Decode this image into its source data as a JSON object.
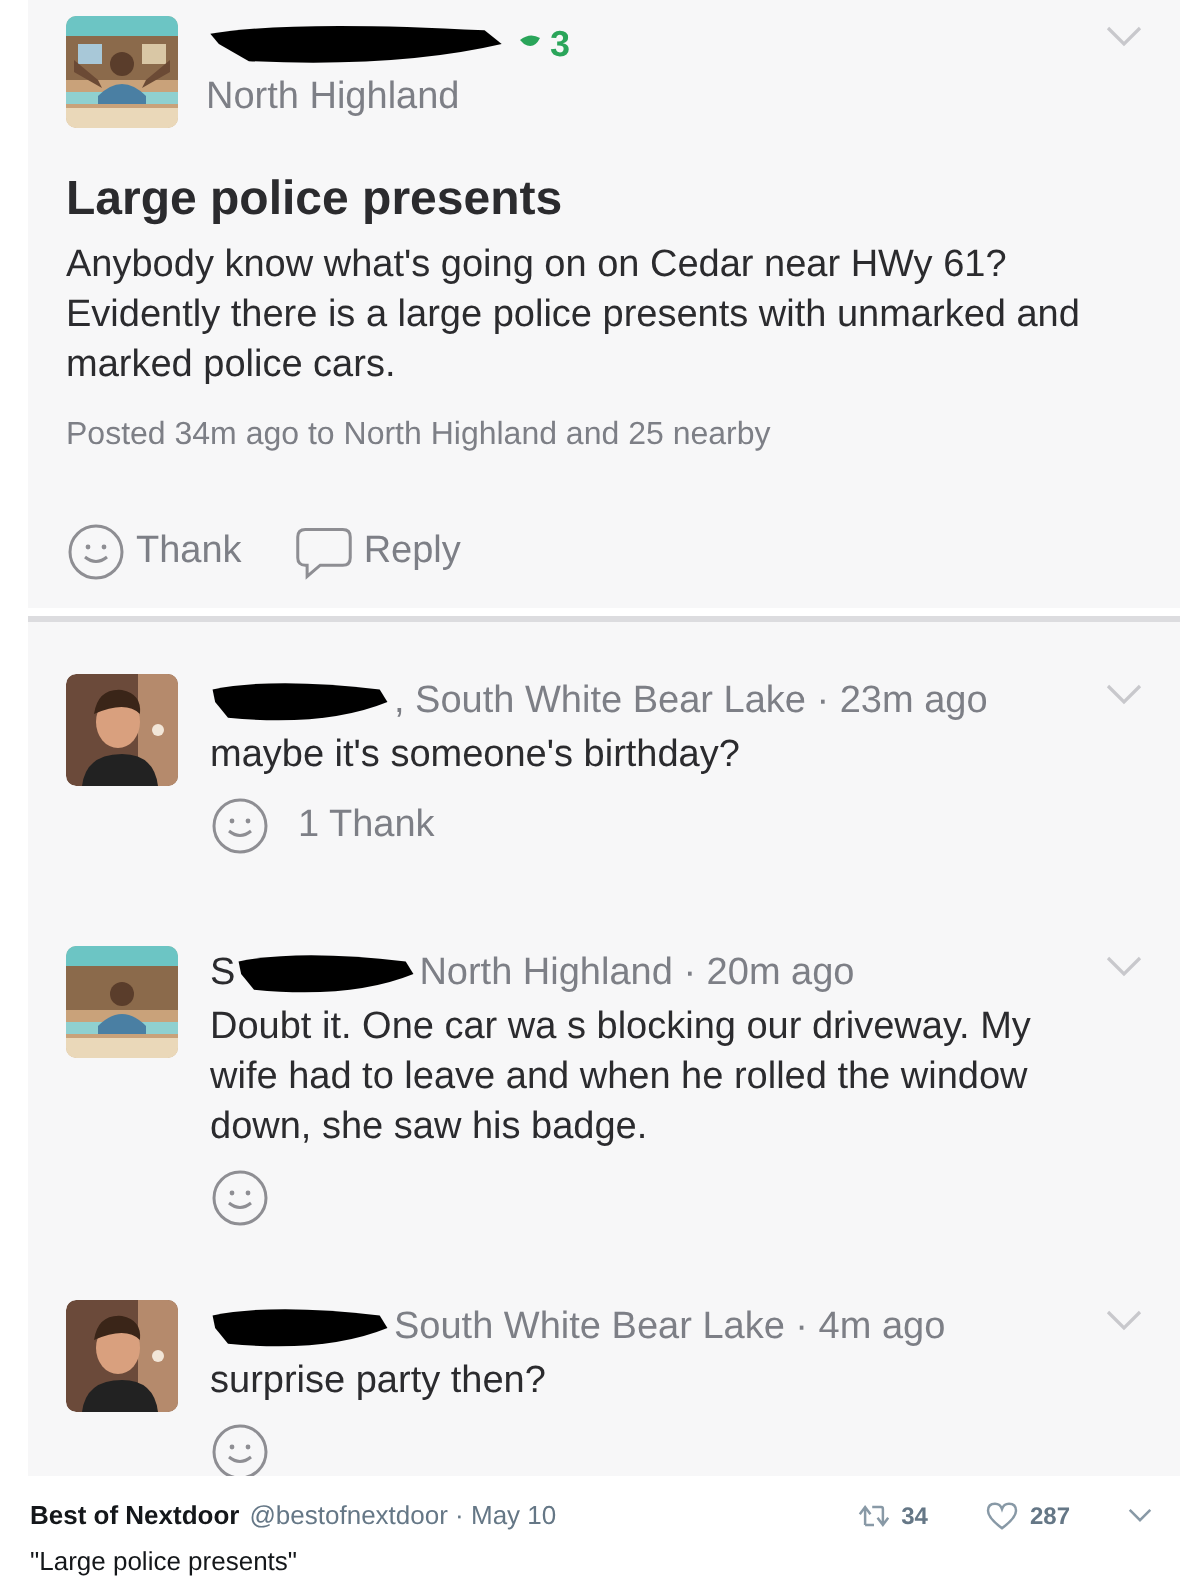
{
  "post": {
    "badge_count": "3",
    "neighborhood": "North Highland",
    "title": "Large police presents",
    "body": "Anybody know what's going on on Cedar near HWy 61? Evidently there is a large police presents with unmarked and marked police cars.",
    "posted": "Posted 34m ago to North Highland and 25 nearby",
    "actions": [
      {
        "kind": "thank",
        "label": "Thank"
      },
      {
        "kind": "reply",
        "label": "Reply"
      }
    ]
  },
  "comments": [
    {
      "meta": ", South White Bear Lake · 23m ago",
      "text": "maybe it's someone's birthday?",
      "thanks": "1 Thank"
    },
    {
      "name_visible": "S",
      "meta": "North Highland · 20m ago",
      "text": "Doubt it. One car wa s blocking our driveway. My wife had to leave and when he rolled the window down, she saw his badge."
    },
    {
      "meta": "South White Bear Lake · 4m ago",
      "text": "surprise party then?"
    }
  ],
  "tweet": {
    "author": "Best of Nextdoor",
    "handle": "@bestofnextdoor · May 10",
    "retweets": "34",
    "likes": "287",
    "text": "\"Large police presents\""
  }
}
